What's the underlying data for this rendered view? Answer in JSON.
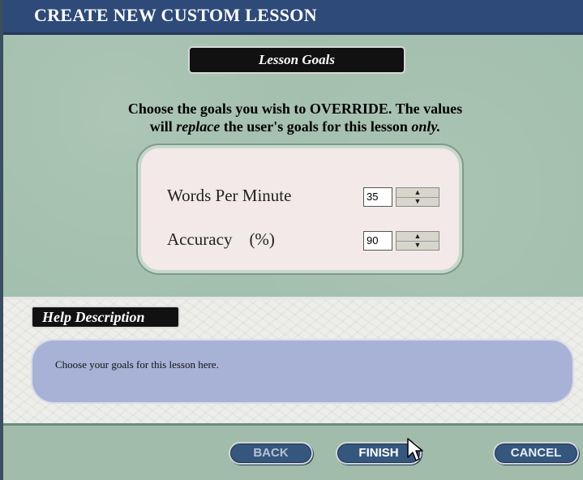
{
  "window": {
    "title": "CREATE NEW CUSTOM LESSON"
  },
  "section": {
    "title": "Lesson Goals"
  },
  "instructions": {
    "part1": "Choose the goals you wish to OVERRIDE.  The values",
    "part2": "will ",
    "part3": "replace",
    "part4": "  the user's goals for this lesson ",
    "part5": "only."
  },
  "goals": [
    {
      "label": "Words Per Minute",
      "value": "35"
    },
    {
      "label": "Accuracy    (%)",
      "value": "90"
    }
  ],
  "help": {
    "title": "Help Description",
    "text": "Choose your goals for this lesson here."
  },
  "buttons": {
    "back": "BACK",
    "finish": "FINISH",
    "cancel": "CANCEL"
  },
  "icons": {
    "spinner_up": "up-arrow-icon",
    "spinner_down": "down-arrow-icon",
    "cursor": "mouse-pointer-icon"
  },
  "colors": {
    "title_bar": "#2e4a78",
    "panel": "#a3bfad",
    "help_box": "#a8b2d6",
    "button": "#35577e"
  }
}
